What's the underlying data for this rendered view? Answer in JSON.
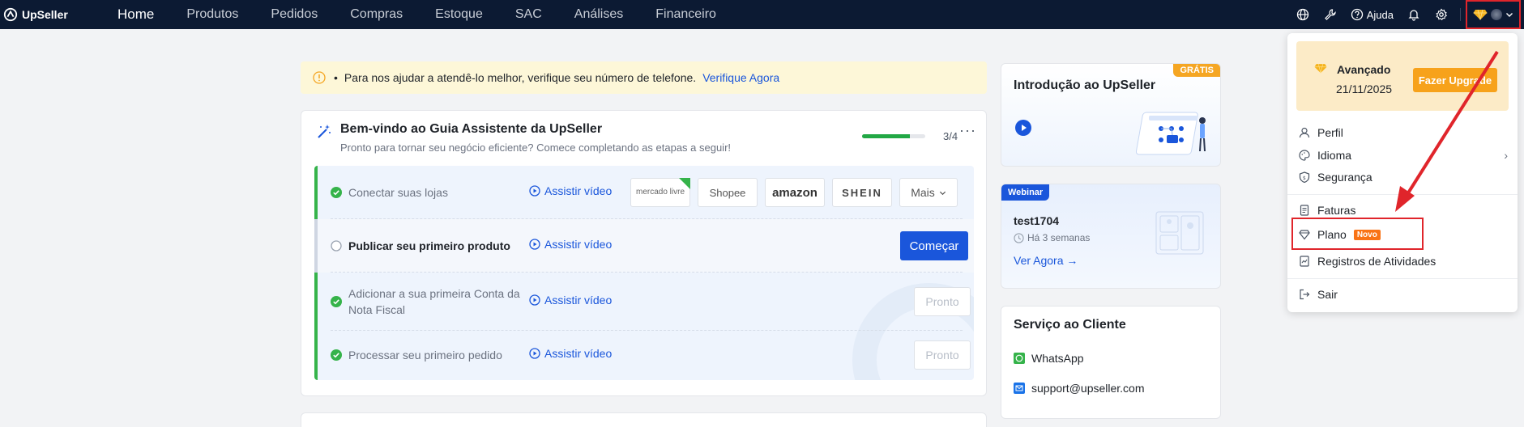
{
  "nav": {
    "logo": "UpSeller",
    "links": [
      "Home",
      "Produtos",
      "Pedidos",
      "Compras",
      "Estoque",
      "SAC",
      "Análises",
      "Financeiro"
    ],
    "help": "Ajuda"
  },
  "banner": {
    "text": "Para nos ajudar a atendê-lo melhor, verifique seu número de telefone.",
    "link": "Verifique Agora"
  },
  "guide": {
    "title": "Bem-vindo ao Guia Assistente da UpSeller",
    "subtitle": "Pronto para tornar seu negócio eficiente? Comece completando as etapas a seguir!",
    "progress_text": "3/4",
    "progress_fraction": 0.75,
    "more": "···",
    "watch_label": "Assistir vídeo",
    "steps": [
      {
        "label": "Conectar suas lojas",
        "done": true
      },
      {
        "label": "Publicar seu primeiro produto",
        "done": false
      },
      {
        "label": "Adicionar a sua primeira Conta da Nota Fiscal",
        "done": true
      },
      {
        "label": "Processar seu primeiro pedido",
        "done": true
      }
    ],
    "stores": [
      "mercado livre",
      "Shopee",
      "amazon",
      "SHEIN",
      "Mais"
    ],
    "start_button": "Começar",
    "done_button": "Pronto"
  },
  "intro": {
    "tag": "GRÁTIS",
    "title": "Introdução ao UpSeller"
  },
  "webinar": {
    "tag": "Webinar",
    "title": "test1704",
    "time": "Há 3 semanas",
    "link": "Ver Agora →"
  },
  "service": {
    "title": "Serviço ao Cliente",
    "whatsapp": "WhatsApp",
    "email": "support@upseller.com"
  },
  "dropdown": {
    "plan_name": "Avançado",
    "plan_date": "21/11/2025",
    "upgrade": "Fazer Upgrade",
    "items": {
      "perfil": "Perfil",
      "idioma": "Idioma",
      "seguranca": "Segurança",
      "faturas": "Faturas",
      "plano": "Plano",
      "plano_badge": "Novo",
      "registros": "Registros de Atividades",
      "sair": "Sair"
    }
  },
  "colors": {
    "nav_bg": "#0c1a33",
    "primary": "#1a56db",
    "success": "#35b34a",
    "highlight": "#e0252b",
    "upgrade": "#f7a21b"
  }
}
